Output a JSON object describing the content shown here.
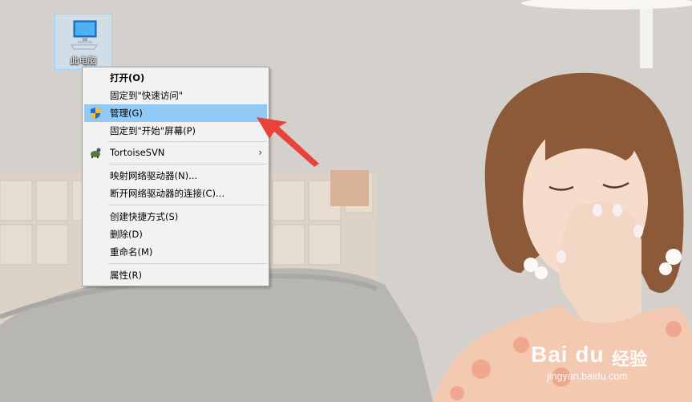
{
  "desktop": {
    "icon_label": "此电脑"
  },
  "context_menu": {
    "items": [
      {
        "label": "打开(O)",
        "bold": true
      },
      {
        "label": "固定到\"快速访问\""
      },
      {
        "label": "管理(G)",
        "icon": "uac-shield-icon",
        "highlighted": true
      },
      {
        "label": "固定到\"开始\"屏幕(P)"
      },
      {
        "label": "TortoiseSVN",
        "icon": "tortoise-svn-icon",
        "submenu": "›"
      },
      {
        "label": "映射网络驱动器(N)..."
      },
      {
        "label": "断开网络驱动器的连接(C)..."
      },
      {
        "label": "创建快捷方式(S)"
      },
      {
        "label": "删除(D)"
      },
      {
        "label": "重命名(M)"
      },
      {
        "label": "属性(R)"
      }
    ]
  },
  "watermark": {
    "logo": "Bai du",
    "brand": "经验",
    "url": "jingyan.baidu.com"
  },
  "colors": {
    "menu_bg": "#f2f2f2",
    "highlight": "#91c9f7",
    "arrow": "#e8433b"
  }
}
